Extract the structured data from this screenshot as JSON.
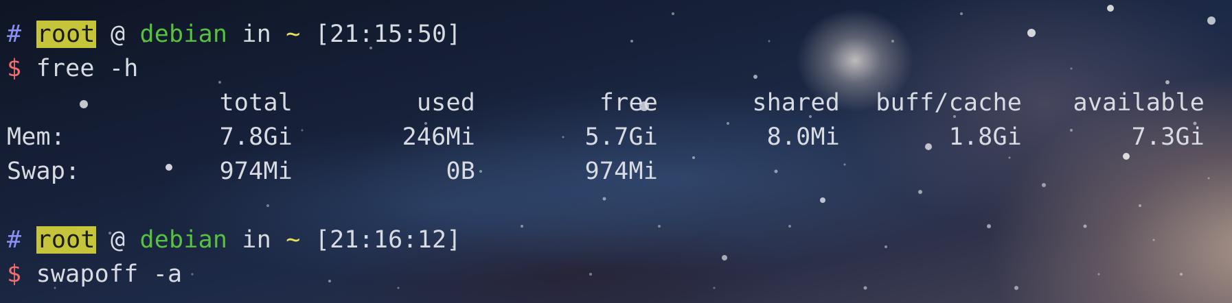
{
  "terminal": {
    "prompts": [
      {
        "hash": "#",
        "user": "root",
        "at": "@",
        "host": "debian",
        "in": "in",
        "dir": "~",
        "time": "[21:15:50]",
        "dollar": "$",
        "command": "free -h"
      },
      {
        "hash": "#",
        "user": "root",
        "at": "@",
        "host": "debian",
        "in": "in",
        "dir": "~",
        "time": "[21:16:12]",
        "dollar": "$",
        "command": "swapoff -a"
      }
    ],
    "free_output": {
      "headers": [
        "total",
        "used",
        "free",
        "shared",
        "buff/cache",
        "available"
      ],
      "rows": [
        {
          "label": "Mem:",
          "values": [
            "7.8Gi",
            "246Mi",
            "5.7Gi",
            "8.0Mi",
            "1.8Gi",
            "7.3Gi"
          ]
        },
        {
          "label": "Swap:",
          "values": [
            "974Mi",
            "0B",
            "974Mi",
            "",
            "",
            ""
          ]
        }
      ]
    },
    "colors": {
      "prompt_hash": "#8a8ff2",
      "user_highlight_bg": "#c6c43a",
      "host": "#58c240",
      "tilde": "#e8e25a",
      "dollar": "#f26f6f",
      "text": "#d8dbe2"
    }
  }
}
